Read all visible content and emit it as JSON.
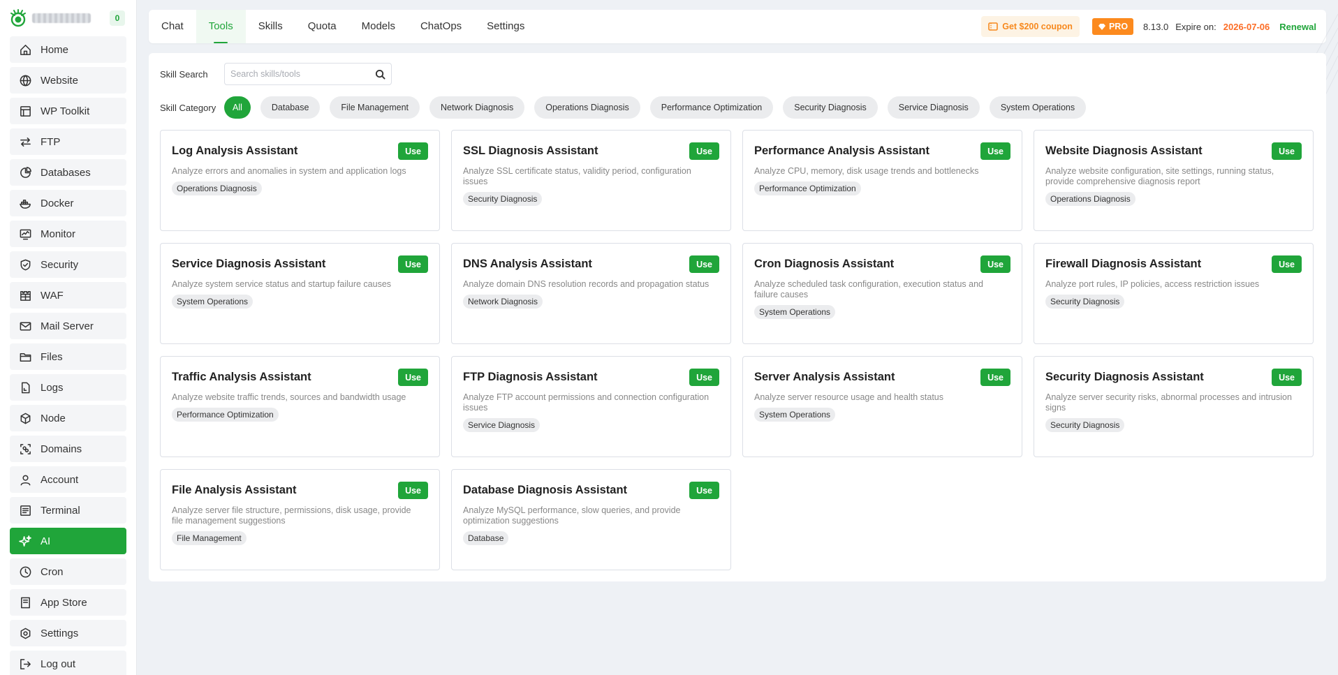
{
  "sidebar": {
    "badge": "0",
    "items": [
      {
        "label": "Home",
        "icon": "home-icon"
      },
      {
        "label": "Website",
        "icon": "globe-icon"
      },
      {
        "label": "WP Toolkit",
        "icon": "wordpress-icon"
      },
      {
        "label": "FTP",
        "icon": "transfer-icon"
      },
      {
        "label": "Databases",
        "icon": "database-icon"
      },
      {
        "label": "Docker",
        "icon": "docker-icon"
      },
      {
        "label": "Monitor",
        "icon": "monitor-icon"
      },
      {
        "label": "Security",
        "icon": "shield-icon"
      },
      {
        "label": "WAF",
        "icon": "castle-icon"
      },
      {
        "label": "Mail Server",
        "icon": "mail-icon"
      },
      {
        "label": "Files",
        "icon": "folder-icon"
      },
      {
        "label": "Logs",
        "icon": "log-icon"
      },
      {
        "label": "Node",
        "icon": "node-icon"
      },
      {
        "label": "Domains",
        "icon": "domains-icon"
      },
      {
        "label": "Account",
        "icon": "user-icon"
      },
      {
        "label": "Terminal",
        "icon": "terminal-icon"
      },
      {
        "label": "AI",
        "icon": "sparkle-icon",
        "active": true
      },
      {
        "label": "Cron",
        "icon": "clock-icon"
      },
      {
        "label": "App Store",
        "icon": "store-icon"
      },
      {
        "label": "Settings",
        "icon": "settings-icon"
      },
      {
        "label": "Log out",
        "icon": "logout-icon"
      }
    ]
  },
  "topbar": {
    "tabs": [
      "Chat",
      "Tools",
      "Skills",
      "Quota",
      "Models",
      "ChatOps",
      "Settings"
    ],
    "active_tab": "Tools",
    "coupon": "Get $200 coupon",
    "pro": "PRO",
    "version": "8.13.0",
    "expire_label": "Expire on:",
    "expire_date": "2026-07-06",
    "renewal": "Renewal"
  },
  "search": {
    "label": "Skill Search",
    "placeholder": "Search skills/tools"
  },
  "category": {
    "label": "Skill Category",
    "items": [
      "All",
      "Database",
      "File Management",
      "Network Diagnosis",
      "Operations Diagnosis",
      "Performance Optimization",
      "Security Diagnosis",
      "Service Diagnosis",
      "System Operations"
    ],
    "active": "All"
  },
  "use_label": "Use",
  "cards": [
    {
      "title": "Log Analysis Assistant",
      "desc": "Analyze errors and anomalies in system and application logs",
      "tag": "Operations Diagnosis"
    },
    {
      "title": "SSL Diagnosis Assistant",
      "desc": "Analyze SSL certificate status, validity period, configuration issues",
      "tag": "Security Diagnosis"
    },
    {
      "title": "Performance Analysis Assistant",
      "desc": "Analyze CPU, memory, disk usage trends and bottlenecks",
      "tag": "Performance Optimization"
    },
    {
      "title": "Website Diagnosis Assistant",
      "desc": "Analyze website configuration, site settings, running status, provide comprehensive diagnosis report",
      "tag": "Operations Diagnosis"
    },
    {
      "title": "Service Diagnosis Assistant",
      "desc": "Analyze system service status and startup failure causes",
      "tag": "System Operations"
    },
    {
      "title": "DNS Analysis Assistant",
      "desc": "Analyze domain DNS resolution records and propagation status",
      "tag": "Network Diagnosis"
    },
    {
      "title": "Cron Diagnosis Assistant",
      "desc": "Analyze scheduled task configuration, execution status and failure causes",
      "tag": "System Operations"
    },
    {
      "title": "Firewall Diagnosis Assistant",
      "desc": "Analyze port rules, IP policies, access restriction issues",
      "tag": "Security Diagnosis"
    },
    {
      "title": "Traffic Analysis Assistant",
      "desc": "Analyze website traffic trends, sources and bandwidth usage",
      "tag": "Performance Optimization"
    },
    {
      "title": "FTP Diagnosis Assistant",
      "desc": "Analyze FTP account permissions and connection configuration issues",
      "tag": "Service Diagnosis"
    },
    {
      "title": "Server Analysis Assistant",
      "desc": "Analyze server resource usage and health status",
      "tag": "System Operations"
    },
    {
      "title": "Security Diagnosis Assistant",
      "desc": "Analyze server security risks, abnormal processes and intrusion signs",
      "tag": "Security Diagnosis"
    },
    {
      "title": "File Analysis Assistant",
      "desc": "Analyze server file structure, permissions, disk usage, provide file management suggestions",
      "tag": "File Management"
    },
    {
      "title": "Database Diagnosis Assistant",
      "desc": "Analyze MySQL performance, slow queries, and provide optimization suggestions",
      "tag": "Database"
    }
  ],
  "colors": {
    "accent": "#20a53a",
    "coupon_text": "#f7891e",
    "pro_bg": "#fc8a1e",
    "expire_date": "#fc6d26"
  }
}
